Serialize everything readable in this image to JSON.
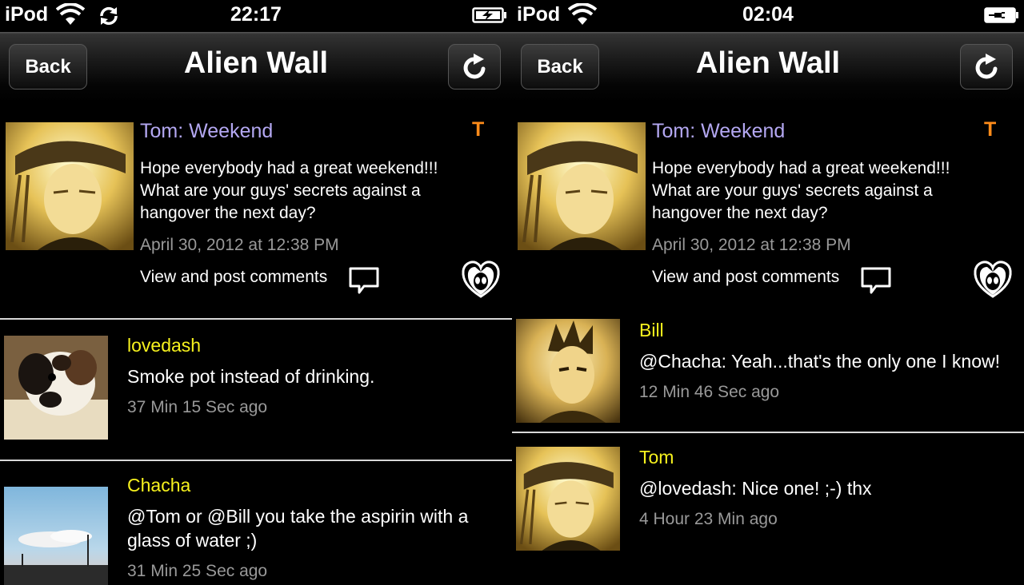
{
  "screens": [
    {
      "status": {
        "carrier": "iPod",
        "time": "22:17",
        "battery": "charging"
      },
      "nav": {
        "back_label": "Back",
        "title": "Alien Wall"
      },
      "post": {
        "author": "Tom: Weekend",
        "source_badge": "T",
        "lines": [
          "Hope everybody had a great weekend!!!",
          "What are your guys' secrets against a",
          "hangover the next day?"
        ],
        "date": "April 30, 2012 at 12:38 PM",
        "comments_link": "View and post comments"
      },
      "comments": [
        {
          "author": "lovedash",
          "lines": [
            "Smoke pot instead of drinking."
          ],
          "time": "37 Min 15 Sec ago"
        },
        {
          "author": "Chacha",
          "lines": [
            "@Tom or @Bill you take the aspirin with a",
            "glass of water ;)"
          ],
          "time": "31 Min 25 Sec ago"
        }
      ]
    },
    {
      "status": {
        "carrier": "iPod",
        "time": "02:04",
        "battery": "plugged"
      },
      "nav": {
        "back_label": "Back",
        "title": "Alien Wall"
      },
      "post": {
        "author": "Tom: Weekend",
        "source_badge": "T",
        "lines": [
          "Hope everybody had a great weekend!!!",
          "What are your guys' secrets against a",
          "hangover the next day?"
        ],
        "date": "April 30, 2012 at 12:38 PM",
        "comments_link": "View and post comments"
      },
      "comments": [
        {
          "author": "Bill",
          "lines": [
            "@Chacha: Yeah...that's the only one I know!"
          ],
          "time": "12 Min 46 Sec ago"
        },
        {
          "author": "Tom",
          "lines": [
            "@lovedash: Nice one! ;-) thx"
          ],
          "time": "4 Hour 23 Min ago"
        }
      ]
    }
  ],
  "colors": {
    "author_post": "#b4a8f2",
    "author_comment": "#f7f21e",
    "badge": "#ff8c1a",
    "muted": "#999999"
  }
}
